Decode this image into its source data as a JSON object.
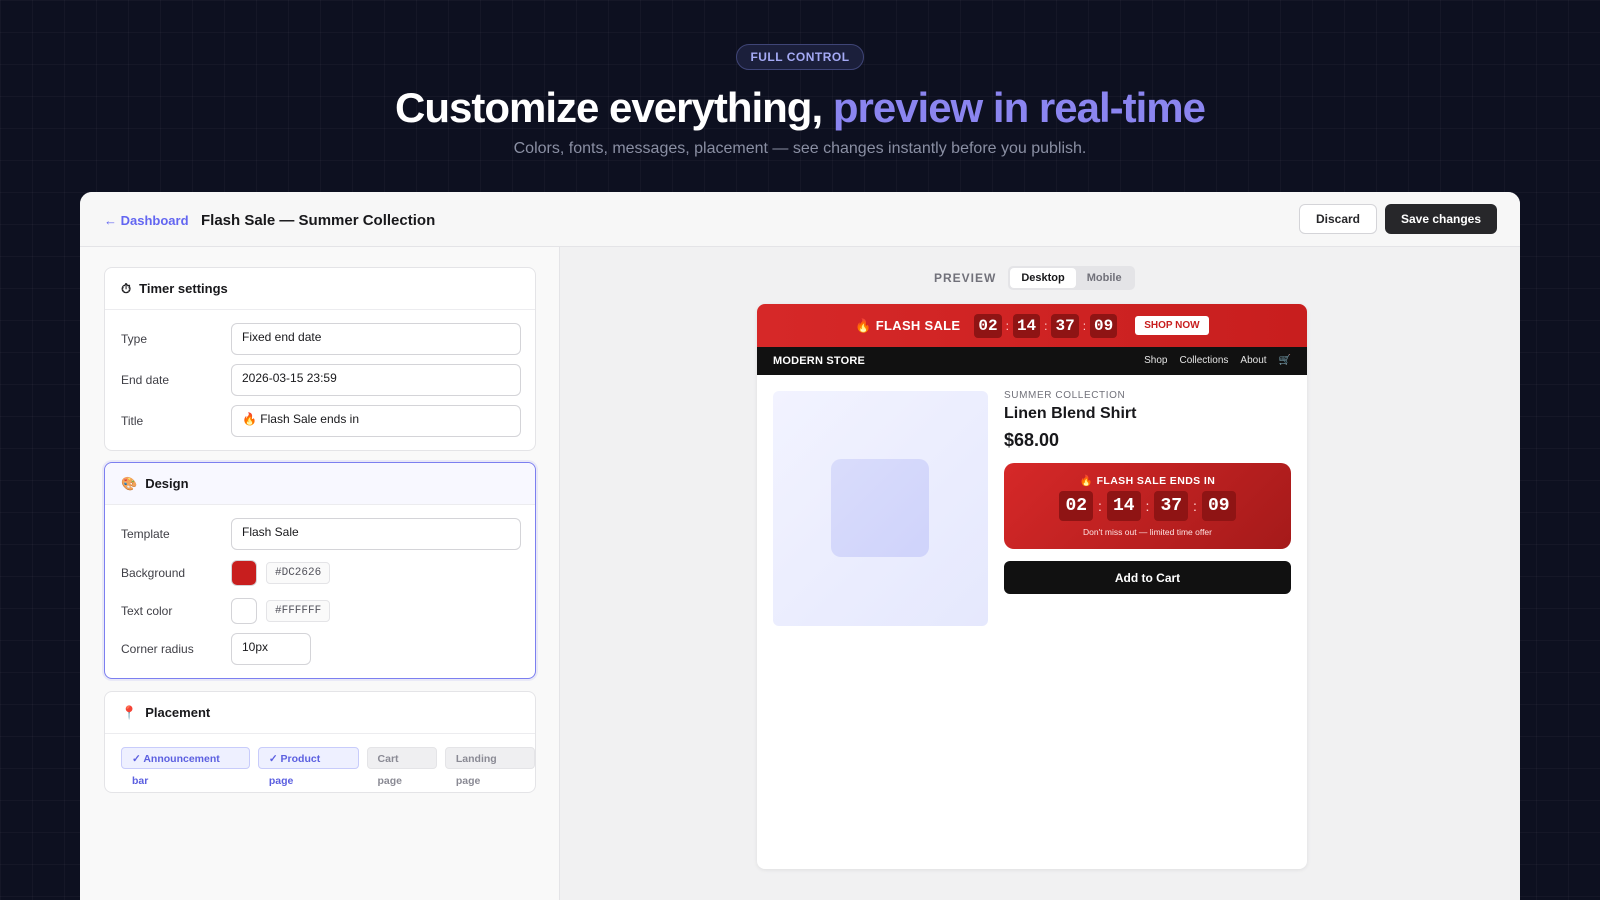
{
  "hero": {
    "badge": "FULL CONTROL",
    "headline_main": "Customize everything,",
    "headline_accent": "preview in real-time",
    "subline": "Colors, fonts, messages, placement — see changes instantly before you publish."
  },
  "topbar": {
    "back_label": "← Dashboard",
    "title": "Flash Sale — Summer Collection",
    "discard_label": "Discard",
    "save_label": "Save changes"
  },
  "timer_settings": {
    "title": "Timer settings",
    "type_label": "Type",
    "type_value": "Fixed end date",
    "end_label": "End date",
    "end_value": "2026-03-15 23:59",
    "title_label": "Title",
    "title_value": "🔥 Flash Sale ends in"
  },
  "design": {
    "title": "Design",
    "template_label": "Template",
    "template_value": "Flash Sale",
    "background_label": "Background",
    "background_hex": "#DC2626",
    "text_color_label": "Text color",
    "text_color_hex": "#FFFFFF",
    "radius_label": "Corner radius",
    "radius_value": "10px"
  },
  "placement": {
    "title": "Placement",
    "chips": [
      {
        "label": "✓ Announcement bar",
        "selected": true
      },
      {
        "label": "✓ Product page",
        "selected": true
      },
      {
        "label": "Cart page",
        "selected": false
      },
      {
        "label": "Landing page",
        "selected": false
      }
    ]
  },
  "preview": {
    "label": "PREVIEW",
    "tabs": [
      "Desktop",
      "Mobile"
    ],
    "selected_tab": "Desktop",
    "announcement": {
      "title": "🔥 FLASH SALE",
      "hours": "02",
      "minutes": "14",
      "seconds": "37",
      "frames": "09",
      "cta": "SHOP NOW"
    },
    "store": {
      "brand": "MODERN STORE",
      "nav": [
        "Shop",
        "Collections",
        "About"
      ],
      "cart_icon": "🛒"
    },
    "product": {
      "collection": "SUMMER COLLECTION",
      "name": "Linen Blend Shirt",
      "price": "$68.00",
      "timer_title": "🔥 FLASH SALE ENDS IN",
      "timer_sub": "Don't miss out — limited time offer",
      "cta": "Add to Cart"
    }
  },
  "colors": {
    "accent": "#6366f1",
    "sale_red": "#DC2626",
    "dark": "#111111"
  }
}
